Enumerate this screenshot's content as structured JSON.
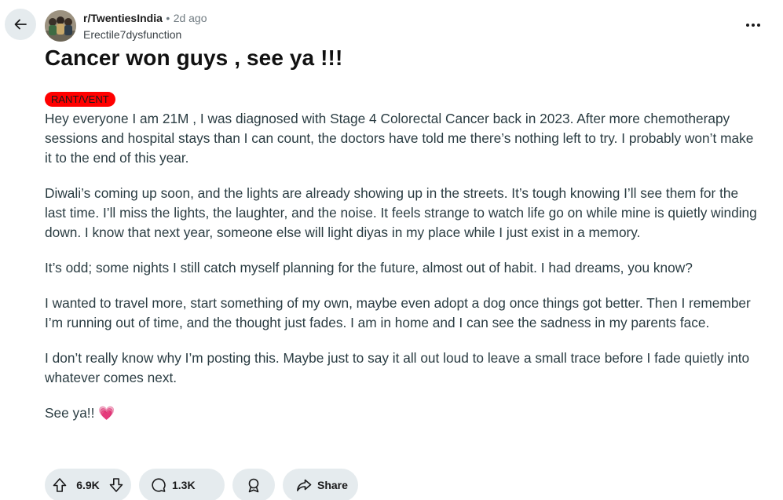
{
  "header": {
    "subreddit": "r/TwentiesIndia",
    "separator": "•",
    "time": "2d ago",
    "username": "Erectile7dysfunction"
  },
  "post": {
    "title": "Cancer won guys , see ya !!!",
    "flair": "RANT/VENT",
    "paragraphs": [
      "Hey everyone I am 21M , I was diagnosed with Stage 4 Colorectal Cancer back in 2023. After more chemotherapy sessions and hospital stays than I can count, the doctors have told me there’s nothing left to try. I probably won’t make it to the end of this year.",
      "Diwali’s coming up soon, and the lights are already showing up in the streets. It’s tough knowing I’ll see them for the last time. I’ll miss the lights, the laughter, and the noise. It feels strange to watch life go on while mine is quietly winding down. I know that next year, someone else will light diyas in my place while I just exist in a memory.",
      "It’s odd; some nights I still catch myself planning for the future, almost out of habit. I had dreams, you know?",
      "I wanted to travel more, start something of my own, maybe even adopt a dog once things got better. Then I remember I’m running out of time, and the thought just fades. I am in home and I can see the sadness in my parents face.",
      "I don’t really know why I’m posting this. Maybe just to say it all out loud to leave a small trace before I fade quietly into whatever comes next."
    ],
    "signoff": "See ya!!",
    "signoff_emoji": "💗"
  },
  "actions": {
    "votes": "6.9K",
    "comments": "1.3K",
    "share": "Share"
  },
  "icons": {
    "back": "arrow-left-icon",
    "more": "more-horizontal-icon",
    "upvote": "upvote-arrow-icon",
    "downvote": "downvote-arrow-icon",
    "comment": "comment-bubble-icon",
    "award": "award-icon",
    "share": "share-arrow-icon"
  },
  "colors": {
    "flair_bg": "#ff0000",
    "button_bg": "#e5ebee",
    "heart": "#ff4f8b"
  }
}
